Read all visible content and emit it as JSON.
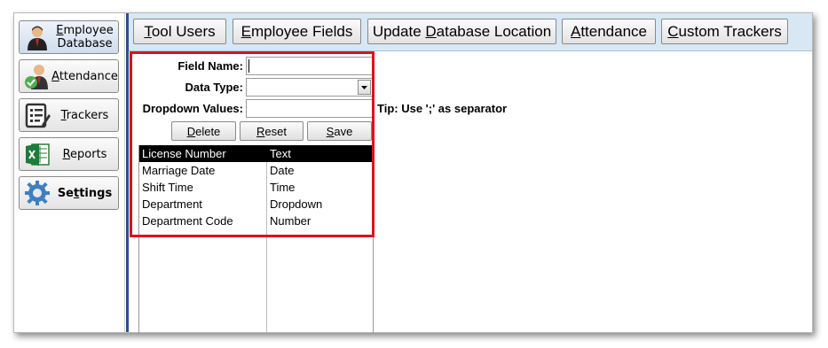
{
  "nav": {
    "items": [
      {
        "label_pre": "",
        "label_u": "E",
        "label_post": "mployee Database",
        "icon": "employee-person-icon"
      },
      {
        "label_pre": "",
        "label_u": "A",
        "label_post": "ttendance",
        "icon": "attendance-person-check-icon"
      },
      {
        "label_pre": "",
        "label_u": "T",
        "label_post": "rackers",
        "icon": "tracker-list-icon"
      },
      {
        "label_pre": "",
        "label_u": "R",
        "label_post": "eports",
        "icon": "excel-report-icon"
      },
      {
        "label_pre": "Se",
        "label_u": "t",
        "label_post": "tings",
        "icon": "gear-icon"
      }
    ]
  },
  "toolbar": {
    "tabs": [
      {
        "pre": "",
        "u": "T",
        "post": "ool Users"
      },
      {
        "pre": "",
        "u": "E",
        "post": "mployee Fields"
      },
      {
        "pre": "Update ",
        "u": "D",
        "post": "atabase Location"
      },
      {
        "pre": "",
        "u": "A",
        "post": "ttendance"
      },
      {
        "pre": "",
        "u": "C",
        "post": "ustom Trackers"
      }
    ]
  },
  "form": {
    "field_name_label": "Field Name:",
    "field_name_value": "",
    "data_type_label": "Data Type:",
    "data_type_value": "",
    "dropdown_values_label": "Dropdown Values:",
    "dropdown_values_value": "",
    "tip": "Tip: Use ';' as separator",
    "delete": {
      "pre": "",
      "u": "D",
      "post": "elete"
    },
    "reset": {
      "pre": "",
      "u": "R",
      "post": "eset"
    },
    "save": {
      "pre": "",
      "u": "S",
      "post": "ave"
    }
  },
  "fields_list": [
    {
      "name": "License Number",
      "type": "Text",
      "selected": true
    },
    {
      "name": "Marriage Date",
      "type": "Date"
    },
    {
      "name": "Shift Time",
      "type": "Time"
    },
    {
      "name": "Department",
      "type": "Dropdown"
    },
    {
      "name": "Department Code",
      "type": "Number"
    }
  ],
  "colors": {
    "highlight": "#e0101a",
    "toolbar_bg": "#d7e8f4",
    "divider": "#2a4f8f"
  }
}
